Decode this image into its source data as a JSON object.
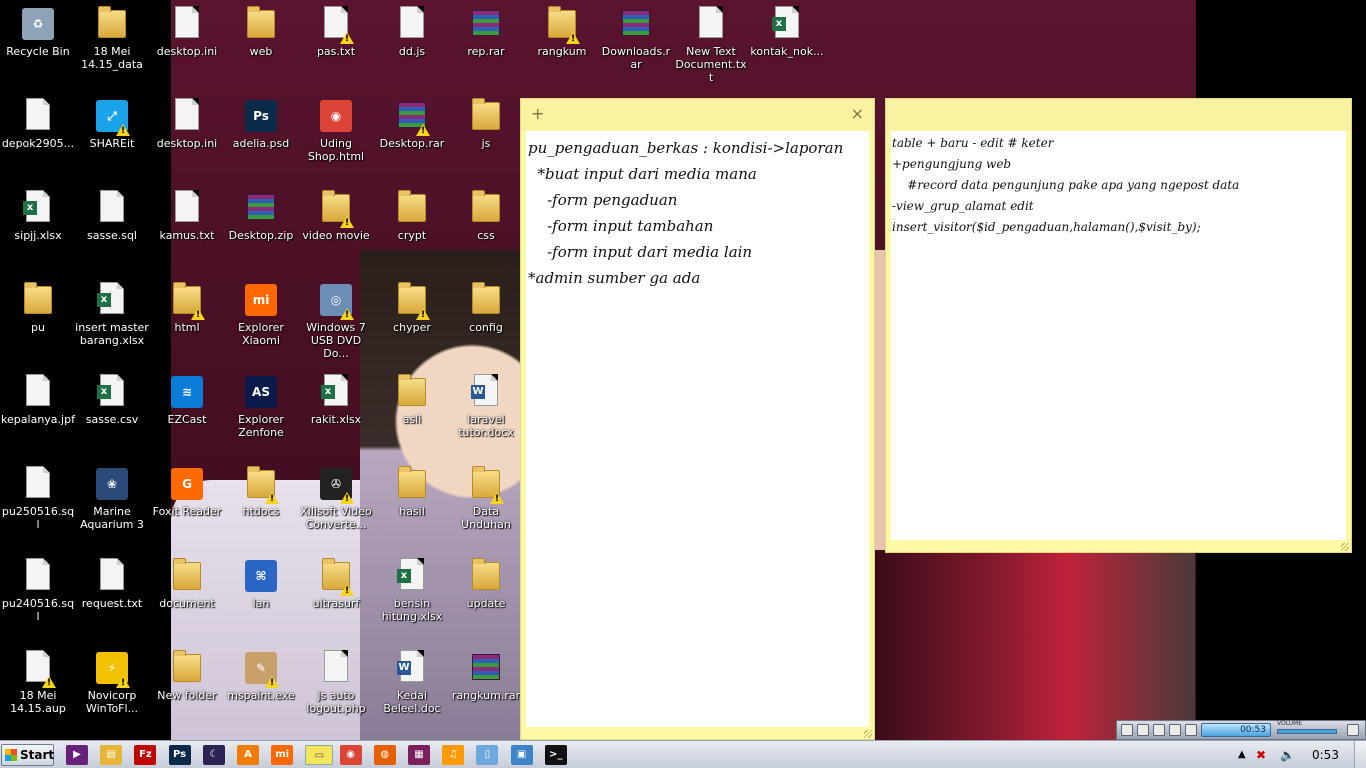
{
  "desktop": {
    "icons": [
      {
        "label": "Recycle Bin",
        "icon": "recycle-bin-icon"
      },
      {
        "label": "18 Mei 14.15_data",
        "icon": "folder-icon"
      },
      {
        "label": "desktop.ini",
        "icon": "ini-file-icon"
      },
      {
        "label": "web",
        "icon": "folder-icon"
      },
      {
        "label": "pas.txt",
        "icon": "text-file-icon"
      },
      {
        "label": "dd.js",
        "icon": "js-file-icon"
      },
      {
        "label": "rep.rar",
        "icon": "rar-archive-icon"
      },
      {
        "label": "rangkum",
        "icon": "folder-icon"
      },
      {
        "label": "Downloads.rar",
        "icon": "rar-archive-icon"
      },
      {
        "label": "New Text Document.txt",
        "icon": "text-file-icon"
      },
      {
        "label": "kontak_nok...",
        "icon": "excel-file-icon"
      },
      {
        "label": "depok2905...",
        "icon": "file-icon"
      },
      {
        "label": "SHAREit",
        "icon": "shareit-icon"
      },
      {
        "label": "desktop.ini",
        "icon": "ini-file-icon"
      },
      {
        "label": "adelia.psd",
        "icon": "photoshop-file-icon"
      },
      {
        "label": "Uding Shop.html",
        "icon": "chrome-html-icon"
      },
      {
        "label": "Desktop.rar",
        "icon": "rar-archive-icon"
      },
      {
        "label": "js",
        "icon": "folder-icon"
      },
      {
        "label": "sipjj.xlsx",
        "icon": "excel-file-icon"
      },
      {
        "label": "sasse.sql",
        "icon": "sql-file-icon"
      },
      {
        "label": "kamus.txt",
        "icon": "text-file-icon"
      },
      {
        "label": "Desktop.zip",
        "icon": "zip-archive-icon"
      },
      {
        "label": "video movie",
        "icon": "folder-icon"
      },
      {
        "label": "crypt",
        "icon": "folder-icon"
      },
      {
        "label": "css",
        "icon": "folder-icon"
      },
      {
        "label": "pu",
        "icon": "folder-icon"
      },
      {
        "label": "insert master barang.xlsx",
        "icon": "excel-file-icon"
      },
      {
        "label": "html",
        "icon": "folder-icon"
      },
      {
        "label": "Explorer Xiaomi",
        "icon": "xiaomi-icon"
      },
      {
        "label": "Windows 7 USB DVD Do...",
        "icon": "usb-dvd-tool-icon"
      },
      {
        "label": "chyper",
        "icon": "folder-icon"
      },
      {
        "label": "config",
        "icon": "folder-icon"
      },
      {
        "label": "kepalanya.jpf",
        "icon": "file-icon"
      },
      {
        "label": "sasse.csv",
        "icon": "csv-file-icon"
      },
      {
        "label": "EZCast",
        "icon": "ezcast-icon"
      },
      {
        "label": "Explorer Zenfone",
        "icon": "asus-icon"
      },
      {
        "label": "rakit.xlsx",
        "icon": "excel-file-icon"
      },
      {
        "label": "asli",
        "icon": "folder-icon"
      },
      {
        "label": "laravel tutor.docx",
        "icon": "word-file-icon"
      },
      {
        "label": "pu250516.sql",
        "icon": "sql-file-icon"
      },
      {
        "label": "Marine Aquarium 3",
        "icon": "aquarium-icon"
      },
      {
        "label": "Foxit Reader",
        "icon": "foxit-icon"
      },
      {
        "label": "htdocs",
        "icon": "folder-icon"
      },
      {
        "label": "Xilisoft Video Converte...",
        "icon": "film-reel-icon"
      },
      {
        "label": "hasil",
        "icon": "folder-icon"
      },
      {
        "label": "Data Unduhan",
        "icon": "folder-icon"
      },
      {
        "label": "pu240516.sql",
        "icon": "sql-file-icon"
      },
      {
        "label": "request.txt",
        "icon": "text-file-icon"
      },
      {
        "label": "document",
        "icon": "folder-icon"
      },
      {
        "label": "lan",
        "icon": "network-icon"
      },
      {
        "label": "ultrasurf",
        "icon": "folder-icon"
      },
      {
        "label": "bensin hitung.xlsx",
        "icon": "excel-file-icon"
      },
      {
        "label": "update",
        "icon": "folder-icon"
      },
      {
        "label": "18 Mei 14.15.aup",
        "icon": "file-icon"
      },
      {
        "label": "Novicorp WinToFl...",
        "icon": "wintoflash-icon"
      },
      {
        "label": "New folder",
        "icon": "folder-icon"
      },
      {
        "label": "mspaint.exe",
        "icon": "paint-palette-icon"
      },
      {
        "label": "js auto logout.php",
        "icon": "php-file-icon"
      },
      {
        "label": "Kedai Beleel.doc",
        "icon": "word-file-icon"
      },
      {
        "label": "rangkum.rar",
        "icon": "rar-archive-icon"
      }
    ]
  },
  "note1": {
    "add": "+",
    "close": "×",
    "lines": [
      "pu_pengaduan_berkas : kondisi->laporan",
      "  *buat input dari media mana",
      "    -form pengaduan",
      "    -form input tambahan",
      "    -form input dari media lain",
      "*admin sumber ga ada"
    ]
  },
  "note2": {
    "lines": [
      "table + baru - edit # keter",
      "+pengungjung web",
      "    #record data pengunjung pake apa yang ngepost data",
      "-view_grup_alamat edit",
      "insert_visitor($id_pengaduan,halaman(),$visit_by);"
    ]
  },
  "media_player": {
    "time": "00:53",
    "volume_label": "VOLUME"
  },
  "taskbar": {
    "start_label": "Start",
    "pinned": [
      {
        "name": "visual-studio-icon",
        "color": "#68217a",
        "glyph": "▶"
      },
      {
        "name": "file-explorer-icon",
        "color": "#e5b53a",
        "glyph": "▤"
      },
      {
        "name": "filezilla-icon",
        "color": "#bf0000",
        "glyph": "Fz"
      },
      {
        "name": "photoshop-icon",
        "color": "#0b2a4a",
        "glyph": "Ps"
      },
      {
        "name": "eclipse-icon",
        "color": "#2c2255",
        "glyph": "☾"
      },
      {
        "name": "avast-icon",
        "color": "#f27d00",
        "glyph": "A"
      },
      {
        "name": "xiaomi-icon",
        "color": "#ff6700",
        "glyph": "mi"
      },
      {
        "name": "sticky-notes-icon",
        "color": "#f5e55a",
        "glyph": "▭"
      },
      {
        "name": "chrome-icon",
        "color": "#db4437",
        "glyph": "◉"
      },
      {
        "name": "firefox-icon",
        "color": "#e66000",
        "glyph": "◍"
      },
      {
        "name": "winrar-icon",
        "color": "#7a1f5c",
        "glyph": "▦"
      },
      {
        "name": "headphones-icon",
        "color": "#ff9900",
        "glyph": "♫"
      },
      {
        "name": "notepad-icon",
        "color": "#6fa8dc",
        "glyph": "▯"
      },
      {
        "name": "remote-desktop-icon",
        "color": "#3d85c6",
        "glyph": "▣"
      },
      {
        "name": "cmd-icon",
        "color": "#111111",
        "glyph": ">_"
      }
    ],
    "clock": "0:53"
  }
}
